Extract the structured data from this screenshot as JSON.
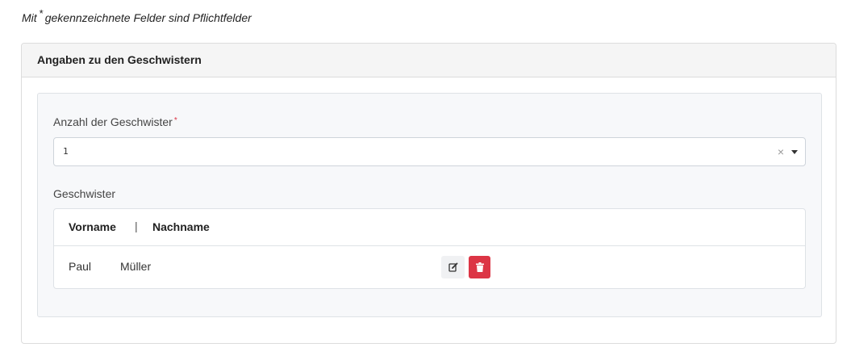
{
  "note": {
    "prefix": "Mit",
    "star": "*",
    "suffix": "gekennzeichnete Felder sind Pflichtfelder"
  },
  "card": {
    "title": "Angaben zu den Geschwistern"
  },
  "siblings_count_field": {
    "label": "Anzahl der Geschwister",
    "required_marker": "*",
    "value": "1",
    "clear_symbol": "×"
  },
  "siblings_table": {
    "label": "Geschwister",
    "columns": [
      "Vorname",
      "Nachname"
    ],
    "separator": "|",
    "rows": [
      {
        "vorname": "Paul",
        "nachname": "Müller"
      }
    ]
  },
  "colors": {
    "delete_button": "#dc3545",
    "required_marker": "#dc3545",
    "panel_background": "#f7f8fa",
    "header_background": "#f5f5f5"
  },
  "icons": {
    "edit": "edit-icon",
    "delete": "trash-icon",
    "dropdown": "caret-down-icon"
  }
}
